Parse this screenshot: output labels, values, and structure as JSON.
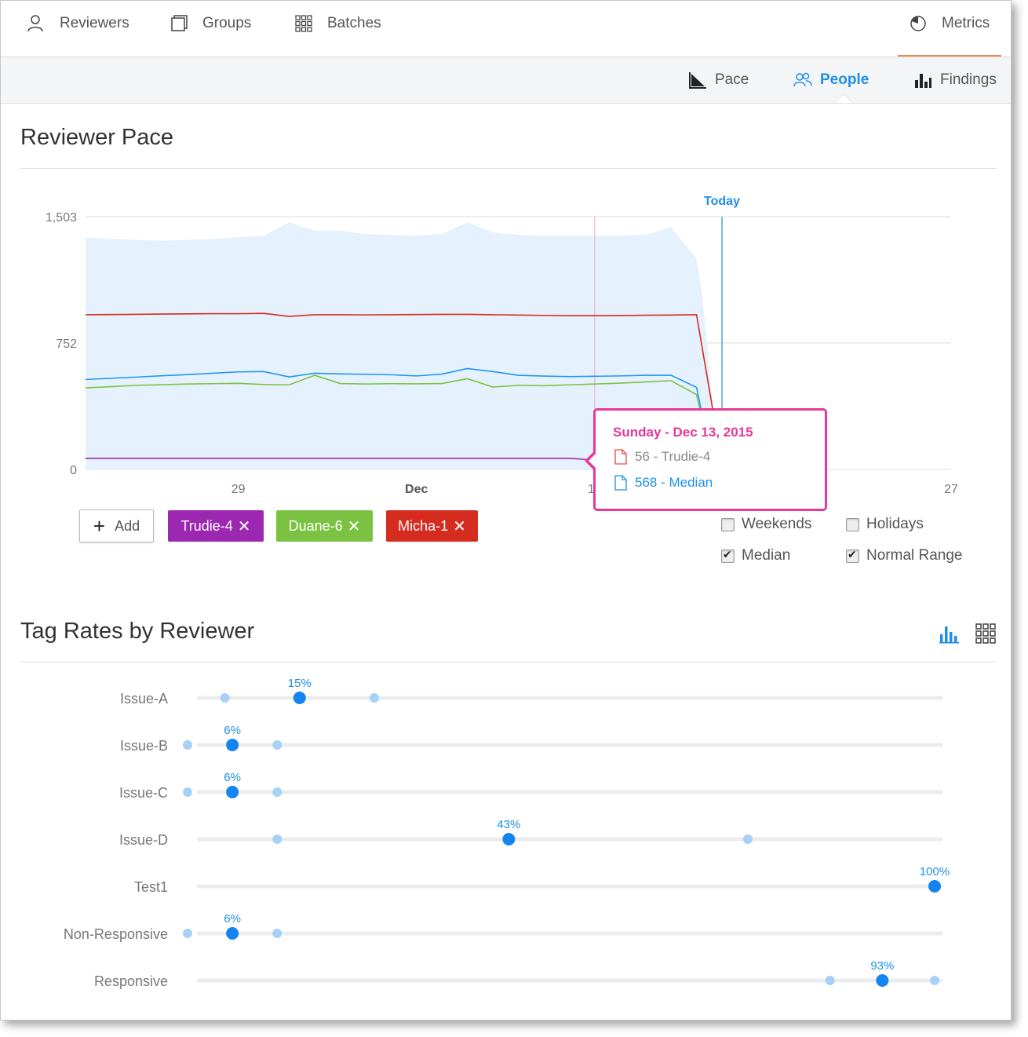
{
  "topnav": {
    "reviewers": "Reviewers",
    "groups": "Groups",
    "batches": "Batches",
    "metrics": "Metrics"
  },
  "subnav": {
    "pace": "Pace",
    "people": "People",
    "findings": "Findings"
  },
  "pace": {
    "title": "Reviewer Pace",
    "today_label": "Today",
    "add_label": "Add",
    "chips": [
      {
        "label": "Trudie-4",
        "color": "#9c27b0"
      },
      {
        "label": "Duane-6",
        "color": "#7cc242"
      },
      {
        "label": "Micha-1",
        "color": "#d62b1f"
      }
    ],
    "options": {
      "weekends": "Weekends",
      "holidays": "Holidays",
      "median": "Median",
      "normal_range": "Normal Range"
    },
    "tooltip": {
      "title": "Sunday - Dec 13, 2015",
      "row1": "56 - Trudie-4",
      "row2": "568 - Median"
    }
  },
  "tags": {
    "title": "Tag Rates by Reviewer"
  },
  "colors": {
    "accent": "#1e8fea",
    "highlight": "#e7399a",
    "band": "#e5f1fc",
    "trudie": "#9c27b0",
    "duane": "#7cc242",
    "micha": "#d62b1f",
    "median": "#2196f3"
  },
  "chart_data": [
    {
      "type": "line",
      "title": "Reviewer Pace",
      "y_ticks": [
        "0",
        "752",
        "1,503"
      ],
      "ylim": [
        0,
        1503
      ],
      "x_tick_labels": [
        "29",
        "Dec",
        "13",
        "27"
      ],
      "x_tick_dates": [
        "2015-11-29",
        "2015-12-06",
        "2015-12-13",
        "2015-12-27"
      ],
      "today": "2015-12-18",
      "x": [
        "2015-11-23",
        "2015-11-24",
        "2015-11-25",
        "2015-11-26",
        "2015-11-27",
        "2015-11-28",
        "2015-11-29",
        "2015-11-30",
        "2015-12-01",
        "2015-12-02",
        "2015-12-03",
        "2015-12-04",
        "2015-12-05",
        "2015-12-06",
        "2015-12-07",
        "2015-12-08",
        "2015-12-09",
        "2015-12-10",
        "2015-12-11",
        "2015-12-12",
        "2015-12-13",
        "2015-12-14",
        "2015-12-15",
        "2015-12-16",
        "2015-12-17"
      ],
      "series": [
        {
          "name": "Micha-1",
          "color": "#d62b1f",
          "values": [
            920,
            921,
            922,
            924,
            925,
            926,
            926,
            928,
            910,
            920,
            920,
            919,
            920,
            921,
            922,
            922,
            920,
            918,
            916,
            914,
            914,
            915,
            917,
            918,
            920
          ]
        },
        {
          "name": "Median",
          "color": "#2196f3",
          "values": [
            535,
            542,
            549,
            557,
            564,
            572,
            580,
            582,
            550,
            572,
            568,
            566,
            563,
            556,
            567,
            600,
            582,
            560,
            555,
            552,
            554,
            556,
            560,
            560,
            488
          ]
        },
        {
          "name": "Duane-6",
          "color": "#7cc242",
          "values": [
            485,
            492,
            500,
            504,
            508,
            510,
            512,
            505,
            503,
            560,
            511,
            508,
            510,
            509,
            511,
            540,
            490,
            500,
            498,
            503,
            508,
            513,
            520,
            528,
            445
          ]
        },
        {
          "name": "Trudie-4",
          "color": "#9c27b0",
          "values": [
            66,
            66,
            66,
            66,
            66,
            66,
            66,
            66,
            66,
            66,
            66,
            66,
            66,
            66,
            66,
            66,
            66,
            66,
            66,
            66,
            56,
            56,
            56,
            56,
            56
          ]
        }
      ],
      "legend_position": "bottom",
      "grid": true
    },
    {
      "type": "scatter",
      "title": "Tag Rates by Reviewer",
      "categories": [
        "Issue-A",
        "Issue-B",
        "Issue-C",
        "Issue-D",
        "Test1",
        "Non-Responsive",
        "Responsive"
      ],
      "xlim": [
        0,
        100
      ],
      "median_pct": [
        15,
        6,
        6,
        43,
        100,
        6,
        93
      ],
      "median_labels": [
        "15%",
        "6%",
        "6%",
        "43%",
        "100%",
        "6%",
        "93%"
      ],
      "range_low_pct": [
        5,
        0,
        0,
        12,
        null,
        0,
        86
      ],
      "range_high_pct": [
        25,
        12,
        12,
        75,
        null,
        12,
        100
      ]
    }
  ]
}
